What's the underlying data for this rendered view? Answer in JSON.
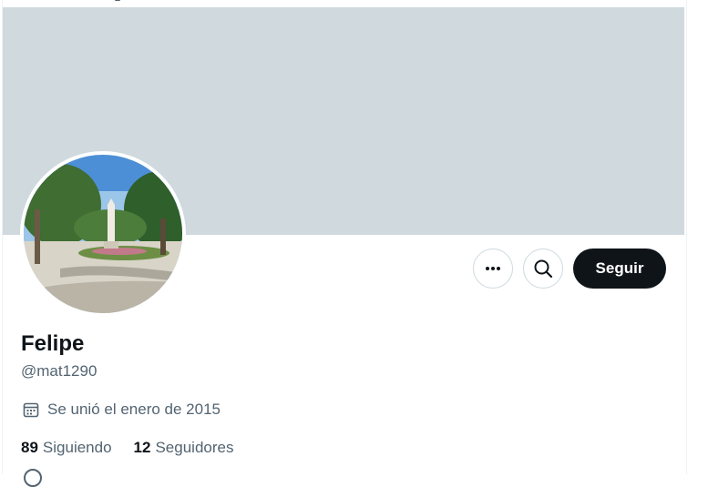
{
  "profile": {
    "name": "Felipe",
    "handle": "@mat1290",
    "joined": "Se unió el enero de 2015"
  },
  "actions": {
    "more_icon": "more-horizontal-icon",
    "search_icon": "search-icon",
    "follow_label": "Seguir"
  },
  "stats": {
    "following_count": "89",
    "following_label": "Siguiendo",
    "followers_count": "12",
    "followers_label": "Seguidores"
  },
  "colors": {
    "banner": "#cfd9de",
    "follow_button": "#0f1419",
    "secondary_text": "#536471"
  }
}
